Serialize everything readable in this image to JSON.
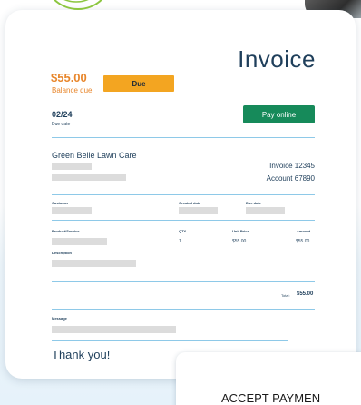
{
  "invoice": {
    "title": "Invoice",
    "balance_amount": "$55.00",
    "balance_label": "Balance due",
    "status_badge": "Due",
    "due_date": "02/24",
    "due_date_label": "Due date",
    "pay_button": "Pay online",
    "business_name": "Green Belle Lawn Care",
    "invoice_number": "Invoice 12345",
    "account_number": "Account 67890",
    "headers": {
      "customer": "Customer",
      "created_date": "Created date",
      "due_date": "Due date"
    },
    "line_items": {
      "headers": {
        "product": "Product/Service",
        "qty": "QTY",
        "unit_price": "Unit Price",
        "amount": "Amount"
      },
      "row": {
        "qty": "1",
        "unit_price": "$55.00",
        "amount": "$55.00"
      },
      "description_label": "Description"
    },
    "total_label": "Total:",
    "total_value": "$55.00",
    "message_label": "Message",
    "thank_you": "Thank you!"
  },
  "accept_card": {
    "heading": "ACCEPT PAYMEN"
  },
  "colors": {
    "navy": "#1f3f5b",
    "orange": "#e8862b",
    "badge_yellow": "#f3a521",
    "pay_green": "#168a5a",
    "rule_blue": "#8ec9e8",
    "logo_green": "#8cc63f"
  },
  "icons": {
    "logo": "leaf-logo-icon"
  }
}
